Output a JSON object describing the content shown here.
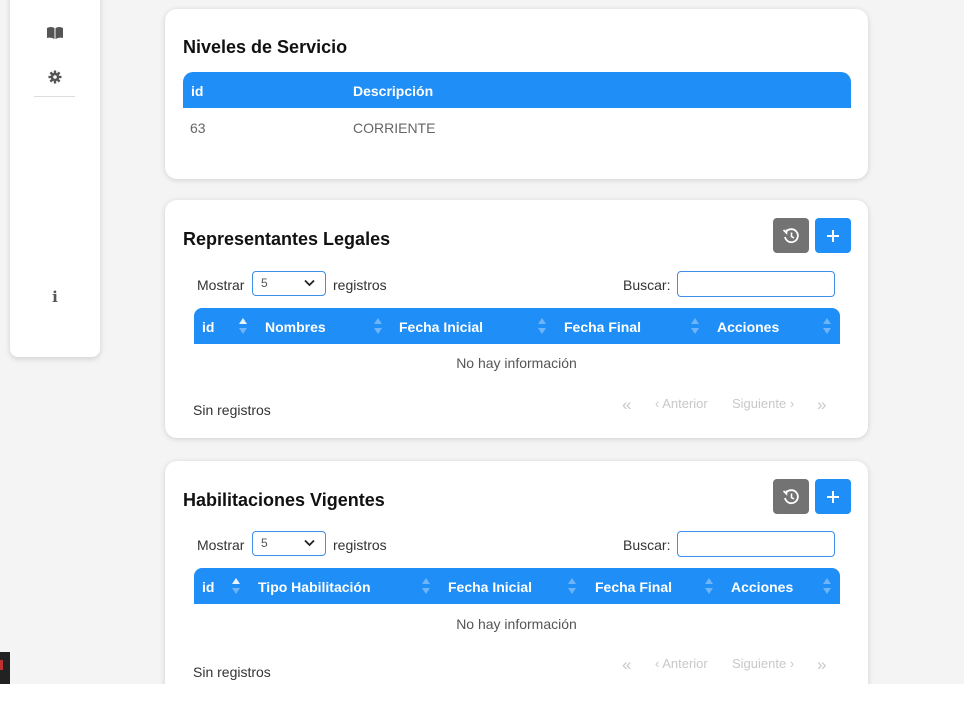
{
  "niveles": {
    "title": "Niveles de Servicio",
    "columns": [
      "id",
      "Descripción"
    ],
    "rows": [
      [
        "63",
        "CORRIENTE"
      ]
    ]
  },
  "representantes": {
    "title": "Representantes Legales",
    "show_prefix": "Mostrar",
    "show_value": "5",
    "show_suffix": "registros",
    "search_label": "Buscar:",
    "search_value": "",
    "columns": [
      "id",
      "Nombres",
      "Fecha Inicial",
      "Fecha Final",
      "Acciones"
    ],
    "empty_message": "No hay información",
    "footer_info": "Sin registros",
    "pager": {
      "first": "«",
      "prev": "‹ Anterior",
      "next": "Siguiente ›",
      "last": "»"
    }
  },
  "habilitaciones": {
    "title": "Habilitaciones Vigentes",
    "show_prefix": "Mostrar",
    "show_value": "5",
    "show_suffix": "registros",
    "search_label": "Buscar:",
    "search_value": "",
    "columns": [
      "id",
      "Tipo Habilitación",
      "Fecha Inicial",
      "Fecha Final",
      "Acciones"
    ],
    "empty_message": "No hay información",
    "footer_info": "Sin registros",
    "pager": {
      "first": "«",
      "prev": "‹ Anterior",
      "next": "Siguiente ›",
      "last": "»"
    }
  },
  "sidebar": {
    "icons": [
      "book-icon",
      "gear-icon",
      "info-icon"
    ],
    "info_glyph": "i"
  },
  "colors": {
    "primary": "#1f8ff7",
    "history_button": "#737373"
  }
}
